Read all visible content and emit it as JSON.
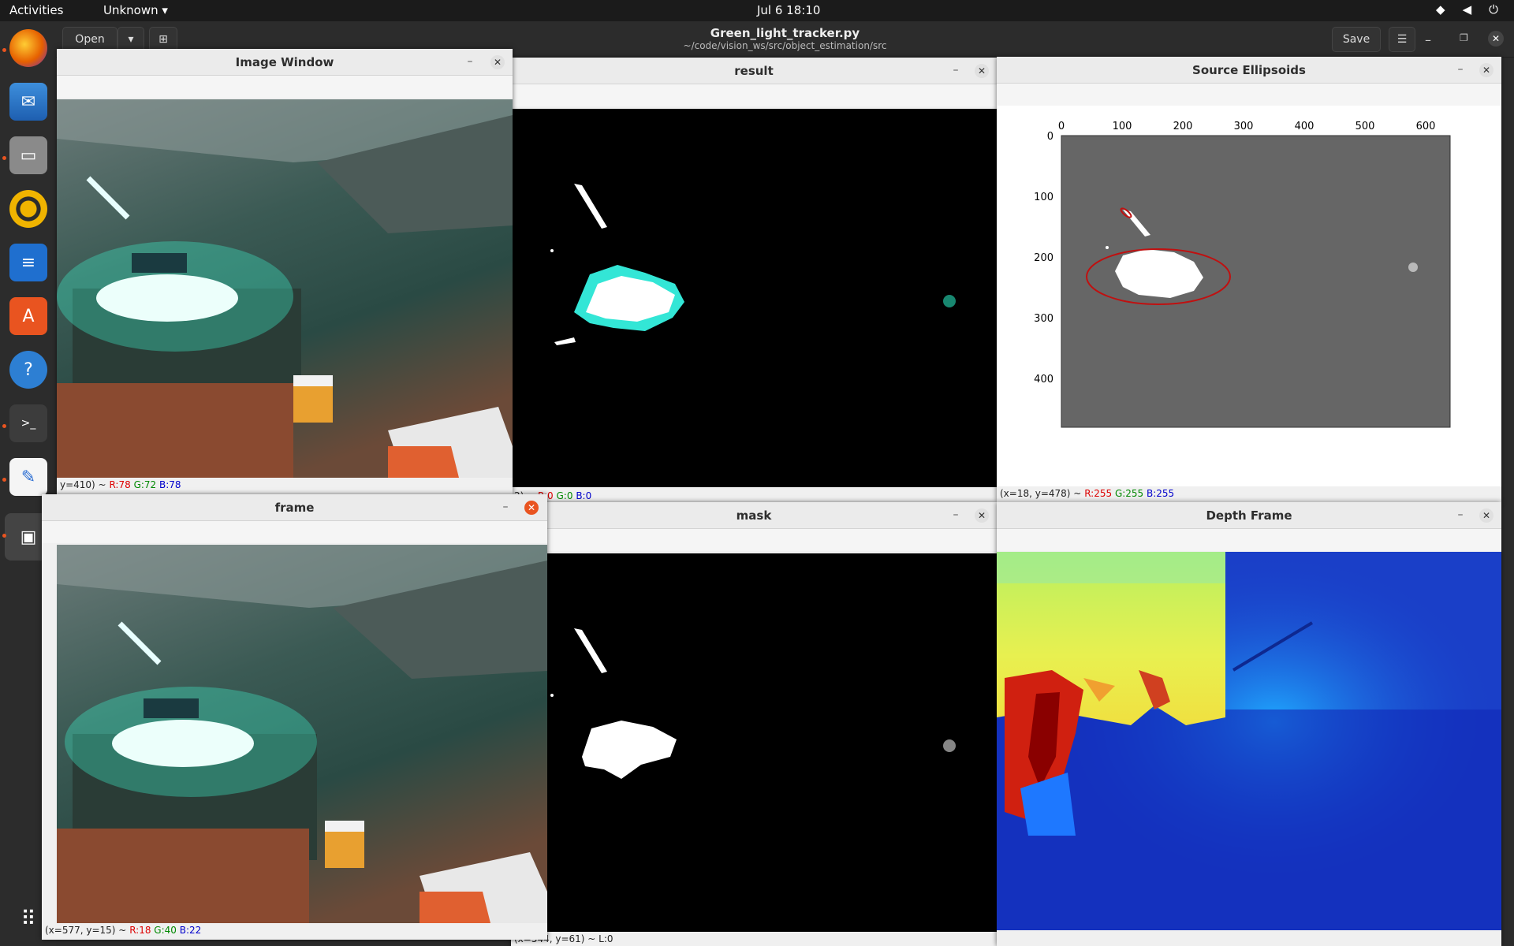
{
  "topbar": {
    "activities": "Activities",
    "app_menu": "Unknown",
    "clock": "Jul 6  18:10"
  },
  "icons": {
    "wifi": "wifi-icon",
    "volume": "volume-icon",
    "power": "power-icon"
  },
  "gedit": {
    "open_label": "Open",
    "save_label": "Save",
    "title": "Green_light_tracker.py",
    "path": "~/code/vision_ws/src/object_estimation/src"
  },
  "windows": {
    "image_window": {
      "title": "Image Window",
      "status_prefix": "y=410) ~",
      "r": "R:78",
      "g": "G:72",
      "b": "B:78"
    },
    "result": {
      "title": "result",
      "status_prefix": "2) ~",
      "r": "R:0",
      "g": "G:0",
      "b": "B:0"
    },
    "source_ellipsoids": {
      "title": "Source Ellipsoids",
      "status_prefix": "(x=18, y=478) ~",
      "r": "R:255",
      "g": "G:255",
      "b": "B:255",
      "x_ticks": [
        "0",
        "100",
        "200",
        "300",
        "400",
        "500",
        "600"
      ],
      "y_ticks": [
        "0",
        "100",
        "200",
        "300",
        "400"
      ]
    },
    "frame": {
      "title": "frame",
      "status_prefix": "(x=577, y=15) ~",
      "r": "R:18",
      "g": "G:40",
      "b": "B:22"
    },
    "mask": {
      "title": "mask",
      "status": "(x=544, y=61) ~ L:0"
    },
    "depth_frame": {
      "title": "Depth Frame"
    }
  },
  "colors": {
    "accent": "#e95420",
    "teal_light": "#2fe0c0",
    "plot_bg": "#666666",
    "ellipse": "#c01010"
  }
}
